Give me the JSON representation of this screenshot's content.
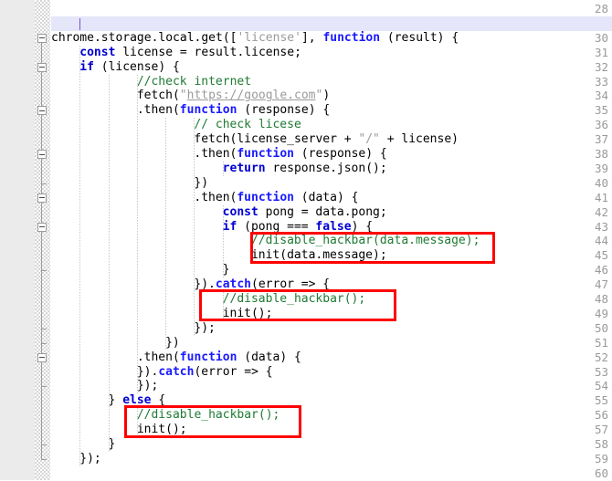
{
  "editor": {
    "language": "javascript",
    "first_line": 28,
    "last_line": 60,
    "current_line": 29,
    "colors": {
      "background": "#ffffff",
      "gutter_background": "#ebebeb",
      "line_number": "#9a9a9a",
      "keyword": "#0000d0",
      "function": "#1a1aff",
      "comment": "#1f7a33",
      "string": "#9a9a9a",
      "plain_text": "#000000",
      "current_line_highlight": "#e6e6fa",
      "caret": "#7a52c7",
      "annotation_box": "#fe0000",
      "fold_marker": "#9c9c9c"
    }
  },
  "line_numbers": [
    "28",
    "29",
    "30",
    "31",
    "32",
    "33",
    "34",
    "35",
    "36",
    "37",
    "38",
    "39",
    "40",
    "41",
    "42",
    "43",
    "44",
    "45",
    "46",
    "47",
    "48",
    "49",
    "50",
    "51",
    "52",
    "53",
    "54",
    "55",
    "56",
    "57",
    "58",
    "59",
    "60"
  ],
  "lines": [
    {
      "number": "28",
      "indent": 0,
      "tokens": []
    },
    {
      "number": "29",
      "indent": 0,
      "tokens": []
    },
    {
      "number": "30",
      "indent": 0,
      "tokens": [
        {
          "t": "chrome.storage.local.get([",
          "c": "pl"
        },
        {
          "t": "'license'",
          "c": "str"
        },
        {
          "t": "], ",
          "c": "pl"
        },
        {
          "t": "function",
          "c": "fn"
        },
        {
          "t": " (result) {",
          "c": "pl"
        }
      ]
    },
    {
      "number": "31",
      "indent": 1,
      "tokens": [
        {
          "t": "const",
          "c": "kw"
        },
        {
          "t": " license = result.license;",
          "c": "pl"
        }
      ]
    },
    {
      "number": "32",
      "indent": 1,
      "tokens": [
        {
          "t": "if",
          "c": "kw"
        },
        {
          "t": " (license) {",
          "c": "pl"
        }
      ]
    },
    {
      "number": "33",
      "indent": 3,
      "tokens": [
        {
          "t": "//check internet",
          "c": "cm"
        }
      ]
    },
    {
      "number": "34",
      "indent": 3,
      "tokens": [
        {
          "t": "fetch(",
          "c": "pl"
        },
        {
          "t": "\"",
          "c": "str"
        },
        {
          "t": "https://google.com",
          "c": "url"
        },
        {
          "t": "\"",
          "c": "str"
        },
        {
          "t": ")",
          "c": "pl"
        }
      ]
    },
    {
      "number": "35",
      "indent": 3,
      "tokens": [
        {
          "t": ".then(",
          "c": "pl"
        },
        {
          "t": "function",
          "c": "fn"
        },
        {
          "t": " (response) {",
          "c": "pl"
        }
      ]
    },
    {
      "number": "36",
      "indent": 5,
      "tokens": [
        {
          "t": "// check licese",
          "c": "cm"
        }
      ]
    },
    {
      "number": "37",
      "indent": 5,
      "tokens": [
        {
          "t": "fetch(license_server + ",
          "c": "pl"
        },
        {
          "t": "\"/\"",
          "c": "str"
        },
        {
          "t": " + license)",
          "c": "pl"
        }
      ]
    },
    {
      "number": "38",
      "indent": 5,
      "tokens": [
        {
          "t": ".then(",
          "c": "pl"
        },
        {
          "t": "function",
          "c": "fn"
        },
        {
          "t": " (response) {",
          "c": "pl"
        }
      ]
    },
    {
      "number": "39",
      "indent": 6,
      "tokens": [
        {
          "t": "return",
          "c": "kw"
        },
        {
          "t": " response.json();",
          "c": "pl"
        }
      ]
    },
    {
      "number": "40",
      "indent": 5,
      "tokens": [
        {
          "t": "})",
          "c": "pl"
        }
      ]
    },
    {
      "number": "41",
      "indent": 5,
      "tokens": [
        {
          "t": ".then(",
          "c": "pl"
        },
        {
          "t": "function",
          "c": "fn"
        },
        {
          "t": " (data) {",
          "c": "pl"
        }
      ]
    },
    {
      "number": "42",
      "indent": 6,
      "tokens": [
        {
          "t": "const",
          "c": "kw"
        },
        {
          "t": " pong = data.pong;",
          "c": "pl"
        }
      ]
    },
    {
      "number": "43",
      "indent": 6,
      "tokens": [
        {
          "t": "if",
          "c": "kw"
        },
        {
          "t": " (pong === ",
          "c": "pl"
        },
        {
          "t": "false",
          "c": "kw"
        },
        {
          "t": ") {",
          "c": "pl"
        }
      ]
    },
    {
      "number": "44",
      "indent": 7,
      "tokens": [
        {
          "t": "//disable_hackbar(data.message);",
          "c": "cm"
        }
      ]
    },
    {
      "number": "45",
      "indent": 7,
      "tokens": [
        {
          "t": "init(data.message);",
          "c": "pl"
        }
      ]
    },
    {
      "number": "46",
      "indent": 6,
      "tokens": [
        {
          "t": "}",
          "c": "pl"
        }
      ]
    },
    {
      "number": "47",
      "indent": 5,
      "tokens": [
        {
          "t": "}).",
          "c": "pl"
        },
        {
          "t": "catch",
          "c": "fn"
        },
        {
          "t": "(error => {",
          "c": "pl"
        }
      ]
    },
    {
      "number": "48",
      "indent": 6,
      "tokens": [
        {
          "t": "//disable_hackbar();",
          "c": "cm"
        }
      ]
    },
    {
      "number": "49",
      "indent": 6,
      "tokens": [
        {
          "t": "init();",
          "c": "pl"
        }
      ]
    },
    {
      "number": "50",
      "indent": 5,
      "tokens": [
        {
          "t": "});",
          "c": "pl"
        }
      ]
    },
    {
      "number": "51",
      "indent": 4,
      "tokens": [
        {
          "t": "})",
          "c": "pl"
        }
      ]
    },
    {
      "number": "52",
      "indent": 3,
      "tokens": [
        {
          "t": ".then(",
          "c": "pl"
        },
        {
          "t": "function",
          "c": "fn"
        },
        {
          "t": " (data) {",
          "c": "pl"
        }
      ]
    },
    {
      "number": "53",
      "indent": 3,
      "tokens": [
        {
          "t": "}).",
          "c": "pl"
        },
        {
          "t": "catch",
          "c": "fn"
        },
        {
          "t": "(error => {",
          "c": "pl"
        }
      ]
    },
    {
      "number": "54",
      "indent": 3,
      "tokens": [
        {
          "t": "});",
          "c": "pl"
        }
      ]
    },
    {
      "number": "55",
      "indent": 2,
      "tokens": [
        {
          "t": "} ",
          "c": "pl"
        },
        {
          "t": "else",
          "c": "kw"
        },
        {
          "t": " {",
          "c": "pl"
        }
      ]
    },
    {
      "number": "56",
      "indent": 3,
      "tokens": [
        {
          "t": "//disable_hackbar();",
          "c": "cm"
        }
      ]
    },
    {
      "number": "57",
      "indent": 3,
      "tokens": [
        {
          "t": "init();",
          "c": "pl"
        }
      ]
    },
    {
      "number": "58",
      "indent": 2,
      "tokens": [
        {
          "t": "}",
          "c": "pl"
        }
      ]
    },
    {
      "number": "59",
      "indent": 1,
      "tokens": [
        {
          "t": "});",
          "c": "pl"
        }
      ]
    },
    {
      "number": "60",
      "indent": 0,
      "tokens": []
    }
  ],
  "fold_markers": [
    {
      "line": "30",
      "type": "box"
    },
    {
      "line": "32",
      "type": "box"
    },
    {
      "line": "35",
      "type": "box"
    },
    {
      "line": "38",
      "type": "box"
    },
    {
      "line": "40",
      "type": "tick"
    },
    {
      "line": "41",
      "type": "box"
    },
    {
      "line": "43",
      "type": "box"
    },
    {
      "line": "46",
      "type": "tick"
    },
    {
      "line": "50",
      "type": "tick"
    },
    {
      "line": "51",
      "type": "tick"
    },
    {
      "line": "52",
      "type": "box"
    },
    {
      "line": "54",
      "type": "tick"
    },
    {
      "line": "58",
      "type": "tick"
    },
    {
      "line": "59",
      "type": "end"
    }
  ],
  "annotations": [
    {
      "id": "annotation-box-1",
      "lines": [
        "44",
        "45"
      ],
      "label": "disable_hackbar data.message block"
    },
    {
      "id": "annotation-box-2",
      "lines": [
        "48",
        "49"
      ],
      "label": "disable_hackbar catch block"
    },
    {
      "id": "annotation-box-3",
      "lines": [
        "56",
        "57"
      ],
      "label": "disable_hackbar else block"
    }
  ]
}
